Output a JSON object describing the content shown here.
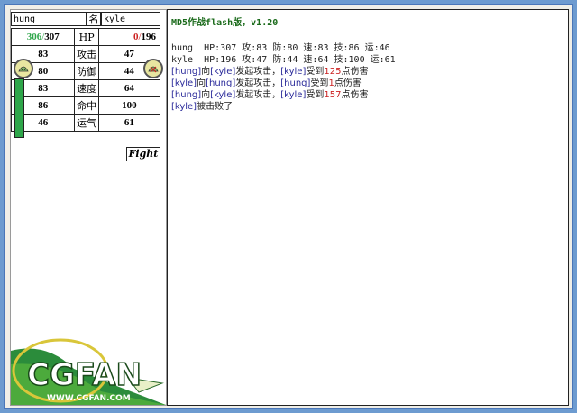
{
  "app": {
    "title": "MD5作战flash版，v1.20"
  },
  "player1": {
    "name": "hung",
    "hp": "306",
    "hp_max": "307",
    "atk": "83",
    "def": "80",
    "spd": "83",
    "hit": "86",
    "luck": "46"
  },
  "player2": {
    "name": "kyle",
    "hp": "0",
    "hp_max": "196",
    "atk": "47",
    "def": "44",
    "spd": "64",
    "hit": "100",
    "luck": "61"
  },
  "labels": {
    "name": "名",
    "hp": "HP",
    "atk": "攻击",
    "def": "防御",
    "spd": "速度",
    "hit": "命中",
    "luck": "运气",
    "fight": "Fight",
    "slash": "/"
  },
  "summary": {
    "line1": "hung  HP:307 攻:83 防:80 速:83 技:86 运:46",
    "line2": "kyle  HP:196 攻:47 防:44 速:64 技:100 运:61"
  },
  "log": [
    {
      "pre": "[hung]",
      "mid1": "向",
      "tgt": "[kyle]",
      "mid2": "发起攻击，",
      "vic": "[kyle]",
      "mid3": "受到",
      "dmg": "125",
      "post": "点伤害"
    },
    {
      "pre": "[kyle]",
      "mid1": "向",
      "tgt": "[hung]",
      "mid2": "发起攻击，",
      "vic": "[hung]",
      "mid3": "受到",
      "dmg": "1",
      "post": "点伤害"
    },
    {
      "pre": "[hung]",
      "mid1": "向",
      "tgt": "[kyle]",
      "mid2": "发起攻击，",
      "vic": "[kyle]",
      "mid3": "受到",
      "dmg": "157",
      "post": "点伤害"
    }
  ],
  "defeat": {
    "who": "[kyle]",
    "text": "被击败了"
  },
  "logo": {
    "text": "CGFAN",
    "url_text": "WWW.CGFAN.COM"
  },
  "colors": {
    "hp_good": "#2ea64a",
    "hp_bad": "#cc2222",
    "damage": "#cc2222",
    "name": "#2a2a9a",
    "title": "#1a6a1a"
  },
  "icons": {
    "avatar1": "slime-face-icon",
    "avatar2": "slime-face-icon"
  }
}
